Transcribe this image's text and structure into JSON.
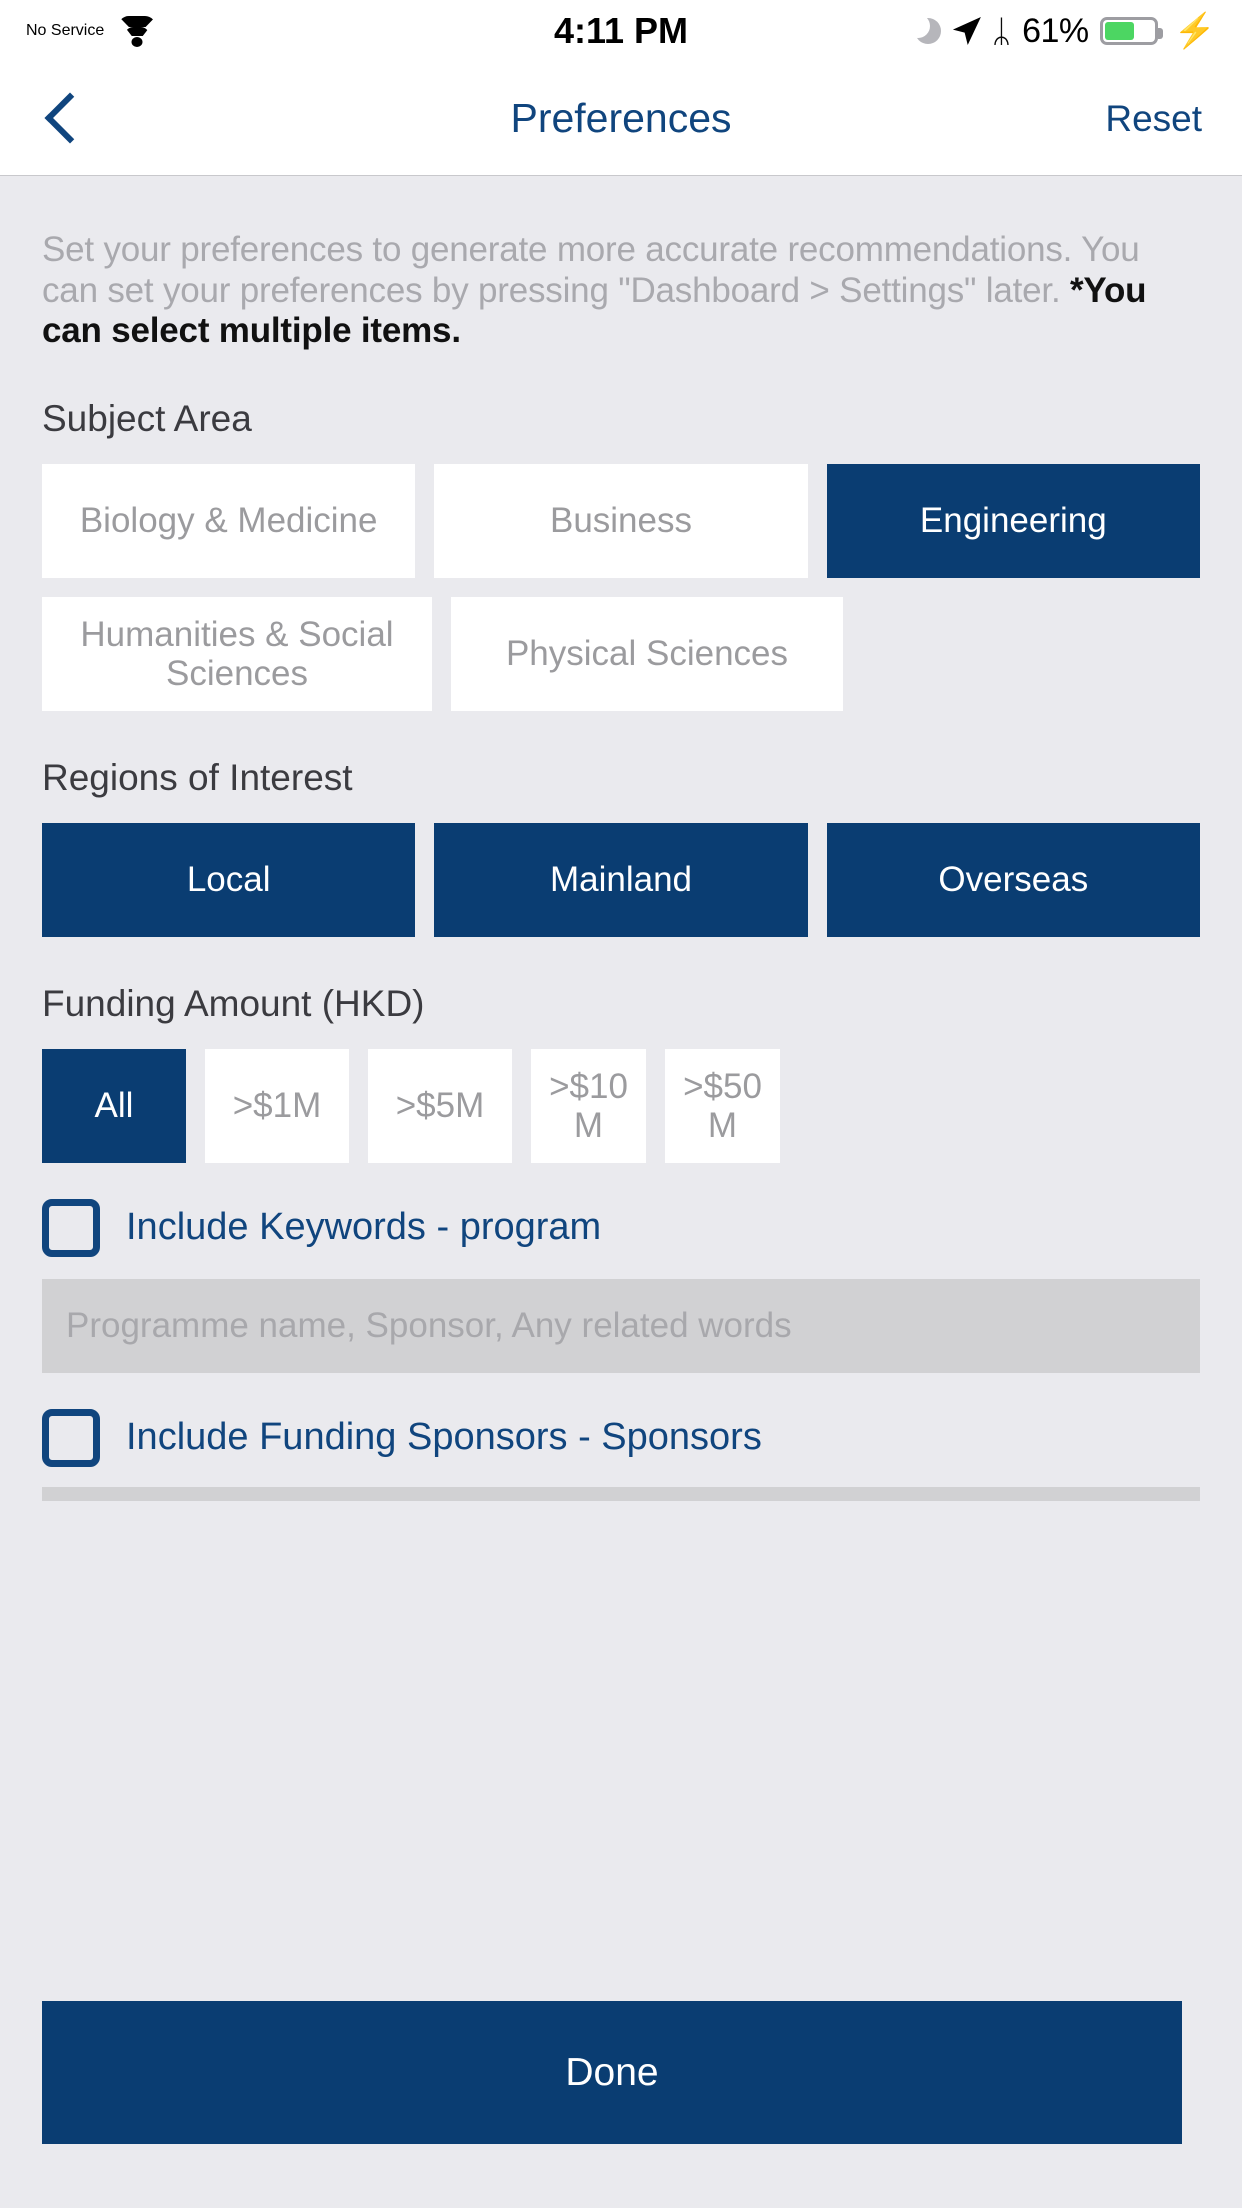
{
  "status_bar": {
    "carrier": "No Service",
    "wifi_icon": "wifi-icon",
    "time": "4:11 PM",
    "dnd_icon": "moon-icon",
    "location_icon": "location-arrow-icon",
    "bluetooth_icon": "⬢",
    "bluetooth_glyph": "ᛦ",
    "battery_percent": "61%",
    "battery_level": 61,
    "charging_icon": "⚡",
    "battery_color": "#4cd662"
  },
  "nav": {
    "back_icon": "chevron-left-icon",
    "title": "Preferences",
    "reset_label": "Reset",
    "accent_color": "#10457e"
  },
  "description": {
    "gray_text": "Set your preferences to generate more accurate recommendations. You can set your preferences by pressing \"Dashboard > Settings\" later. ",
    "bold_text": "*You can select multiple items."
  },
  "subject_area": {
    "title": "Subject Area",
    "row1": [
      {
        "label": "Biology & Medicine",
        "selected": false
      },
      {
        "label": "Business",
        "selected": false
      },
      {
        "label": "Engineering",
        "selected": true
      }
    ],
    "row2": [
      {
        "label": "Humanities & Social Sciences",
        "selected": false
      },
      {
        "label": "Physical Sciences",
        "selected": false
      }
    ]
  },
  "regions": {
    "title": "Regions of Interest",
    "items": [
      {
        "label": "Local",
        "selected": true
      },
      {
        "label": "Mainland",
        "selected": true
      },
      {
        "label": "Overseas",
        "selected": true
      }
    ]
  },
  "funding": {
    "title": "Funding Amount (HKD)",
    "items": [
      {
        "label": "All",
        "selected": true
      },
      {
        "label": ">$1M",
        "selected": false
      },
      {
        "label": ">$5M",
        "selected": false
      },
      {
        "label": ">$10 M",
        "selected": false
      },
      {
        "label": ">$50 M",
        "selected": false
      }
    ]
  },
  "keywords": {
    "checkbox_label": "Include Keywords - program",
    "checked": false,
    "input_value": "",
    "input_placeholder": "Programme name, Sponsor, Any related words"
  },
  "sponsors": {
    "checkbox_label": "Include Funding Sponsors - Sponsors",
    "checked": false,
    "input_value": "",
    "input_placeholder": ""
  },
  "footer": {
    "done_label": "Done",
    "button_color": "#0a3d72"
  }
}
